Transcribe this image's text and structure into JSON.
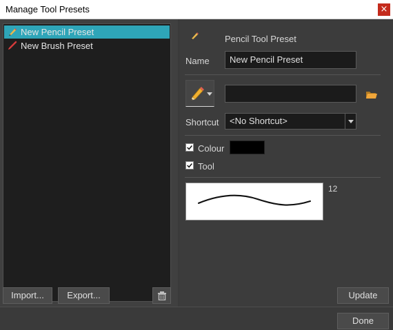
{
  "window": {
    "title": "Manage Tool Presets",
    "close_glyph": "×"
  },
  "presets": [
    {
      "label": "New Pencil Preset",
      "icon": "pencil-icon",
      "selected": true
    },
    {
      "label": "New Brush Preset",
      "icon": "brush-icon",
      "selected": false
    }
  ],
  "left_buttons": {
    "import": "Import...",
    "export": "Export...",
    "delete_icon": "trash-icon"
  },
  "detail": {
    "header": "Pencil Tool Preset",
    "name_label": "Name",
    "name_value": "New Pencil Preset",
    "path_value": "",
    "shortcut_label": "Shortcut",
    "shortcut_value": "<No Shortcut>",
    "colour_label": "Colour",
    "colour_checked": true,
    "colour_value": "#000000",
    "tool_label": "Tool",
    "tool_checked": true,
    "stroke_size": "12",
    "update": "Update"
  },
  "footer": {
    "done": "Done"
  },
  "colors": {
    "selection": "#2ea5b8",
    "close": "#c42b1c",
    "folder": "#e8a33a"
  }
}
